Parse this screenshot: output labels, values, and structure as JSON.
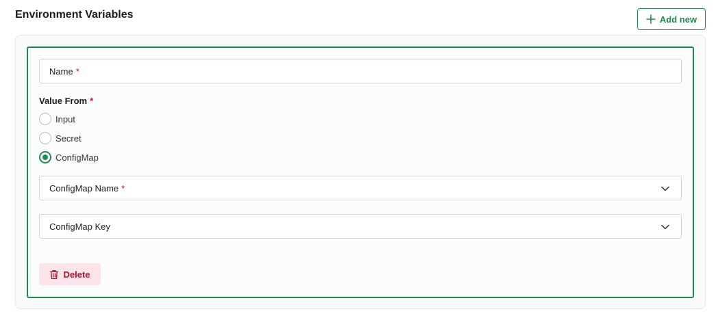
{
  "section": {
    "title": "Environment Variables",
    "add_new_label": "Add new"
  },
  "form": {
    "name_field": {
      "label": "Name",
      "required_mark": "*"
    },
    "value_from": {
      "label": "Value From",
      "required_mark": "*",
      "options": [
        {
          "label": "Input",
          "checked": false
        },
        {
          "label": "Secret",
          "checked": false
        },
        {
          "label": "ConfigMap",
          "checked": true
        }
      ]
    },
    "configmap_name": {
      "label": "ConfigMap Name",
      "required_mark": "*"
    },
    "configmap_key": {
      "label": "ConfigMap Key"
    },
    "delete_label": "Delete"
  },
  "icons": {
    "add": "plus-icon",
    "dropdown": "chevron-down-icon",
    "delete": "trash-icon"
  },
  "colors": {
    "accent": "#1f8b4c",
    "required": "#c8102e",
    "danger_text": "#b3122f",
    "danger_bg": "#fde4e8"
  }
}
